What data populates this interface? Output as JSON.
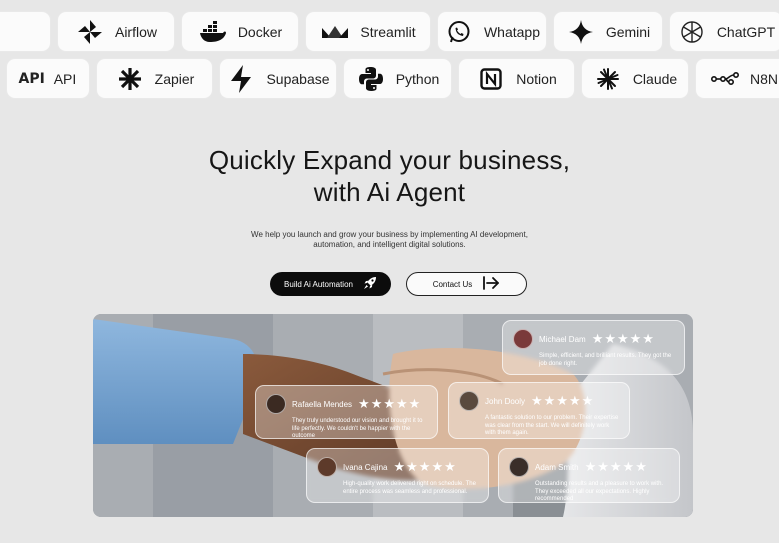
{
  "logos_row1": [
    {
      "label": "",
      "icon": "blank"
    },
    {
      "label": "Airflow",
      "icon": "airflow-icon"
    },
    {
      "label": "Docker",
      "icon": "docker-icon"
    },
    {
      "label": "Streamlit",
      "icon": "streamlit-icon"
    },
    {
      "label": "Whatapp",
      "icon": "whatsapp-icon"
    },
    {
      "label": "Gemini",
      "icon": "gemini-icon"
    },
    {
      "label": "ChatGPT",
      "icon": "chatgpt-icon"
    }
  ],
  "logos_row2": [
    {
      "label": "API",
      "icon": "api-icon"
    },
    {
      "label": "Zapier",
      "icon": "zapier-icon"
    },
    {
      "label": "Supabase",
      "icon": "supabase-icon"
    },
    {
      "label": "Python",
      "icon": "python-icon"
    },
    {
      "label": "Notion",
      "icon": "notion-icon"
    },
    {
      "label": "Claude",
      "icon": "claude-icon"
    },
    {
      "label": "N8N",
      "icon": "n8n-icon"
    }
  ],
  "hero": {
    "title_line1": "Quickly Expand your business,",
    "title_line2": "with Ai Agent",
    "subtitle_line1": "We help you launch and grow your business by implementing AI development,",
    "subtitle_line2": "automation, and intelligent digital solutions.",
    "primary_button": "Build Ai Automation",
    "secondary_button": "Contact Us"
  },
  "testimonials": [
    {
      "name": "Michael Dam",
      "stars": "★★★★★",
      "text": "Simple, efficient, and brilliant results. They got the job done right.",
      "avatar_color": "#7a3a3a"
    },
    {
      "name": "Rafaella Mendes",
      "stars": "★★★★★",
      "text": "They truly understood our vision and brought it to life perfectly. We couldn't be happier with the outcome",
      "avatar_color": "#3b2a22"
    },
    {
      "name": "John Dooly",
      "stars": "★★★★★",
      "text": "A fantastic solution to our problem. Their expertise was clear from the start. We will definitely work with them again.",
      "avatar_color": "#5a4a3e"
    },
    {
      "name": "Ivana Cajina",
      "stars": "★★★★★",
      "text": "High-quality work delivered right on schedule. The entire process was seamless and professional.",
      "avatar_color": "#5d3a2a"
    },
    {
      "name": "Adam Smith",
      "stars": "★★★★★",
      "text": "Outstanding results and a pleasure to work with. They exceeded all our expectations. Highly recommended",
      "avatar_color": "#3a2e29"
    }
  ]
}
